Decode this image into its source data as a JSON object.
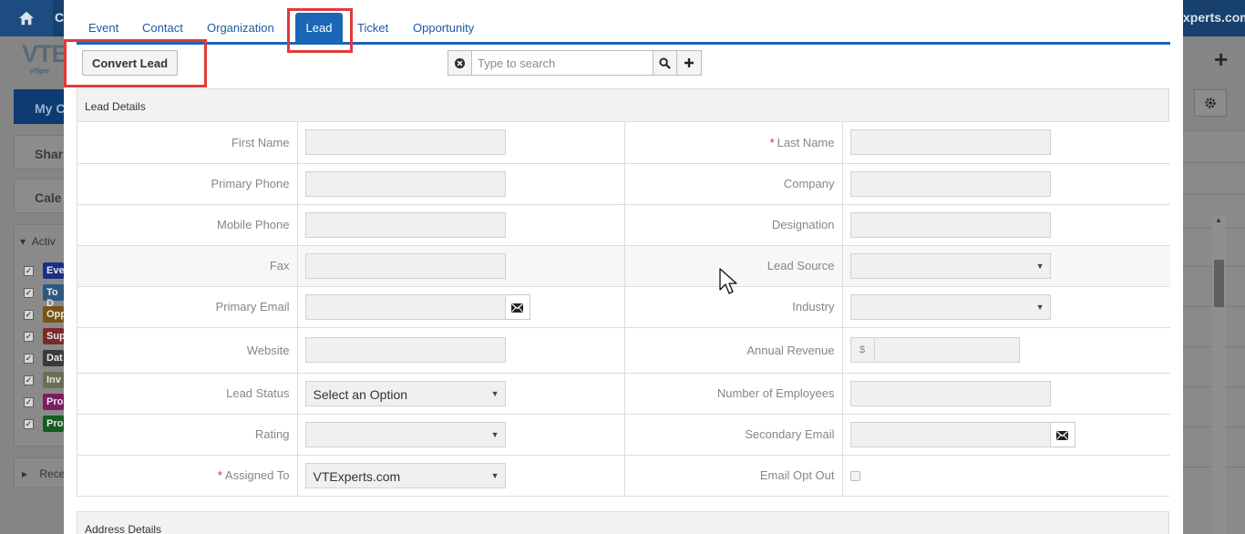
{
  "background": {
    "top_fragment": "C",
    "site_fragment": "xperts.com",
    "logo_fragment": "VTE",
    "logo_sub": "vTiger",
    "my_calendar_fragment": "My C",
    "shared_fragment": "Shar",
    "calendar_fragment": "Cale",
    "activities_fragment": "Activ",
    "recent_fragment": "Rece",
    "activity_tags": [
      {
        "label": "Eve",
        "color": "#1c2e85"
      },
      {
        "label": "To D",
        "color": "#2b5a80"
      },
      {
        "label": "Opp",
        "color": "#7a5311"
      },
      {
        "label": "Sup",
        "color": "#7a2a2a"
      },
      {
        "label": "Dat",
        "color": "#3a3a3a"
      },
      {
        "label": "Inv",
        "color": "#6b6e52"
      },
      {
        "label": "Pro",
        "color": "#7a1d63"
      },
      {
        "label": "Pro",
        "color": "#185c1f"
      }
    ]
  },
  "tabs": [
    "Event",
    "Contact",
    "Organization",
    "Lead",
    "Ticket",
    "Opportunity"
  ],
  "active_tab": "Lead",
  "convert_button": "Convert Lead",
  "search": {
    "placeholder": "Type to search",
    "value": ""
  },
  "lead_details": {
    "title": "Lead Details",
    "rows": [
      {
        "left": {
          "label": "First Name",
          "type": "text",
          "required": false,
          "value": ""
        },
        "right": {
          "label": "Last Name",
          "type": "text",
          "required": true,
          "value": ""
        }
      },
      {
        "left": {
          "label": "Primary Phone",
          "type": "text",
          "required": false,
          "value": ""
        },
        "right": {
          "label": "Company",
          "type": "text",
          "required": false,
          "value": ""
        }
      },
      {
        "left": {
          "label": "Mobile Phone",
          "type": "text",
          "required": false,
          "value": ""
        },
        "right": {
          "label": "Designation",
          "type": "text",
          "required": false,
          "value": ""
        }
      },
      {
        "left": {
          "label": "Fax",
          "type": "text",
          "required": false,
          "value": ""
        },
        "right": {
          "label": "Lead Source",
          "type": "select",
          "required": false,
          "value": ""
        }
      },
      {
        "left": {
          "label": "Primary Email",
          "type": "email",
          "required": false,
          "value": ""
        },
        "right": {
          "label": "Industry",
          "type": "select",
          "required": false,
          "value": ""
        }
      },
      {
        "left": {
          "label": "Website",
          "type": "text",
          "required": false,
          "value": ""
        },
        "right": {
          "label": "Annual Revenue",
          "type": "currency",
          "required": false,
          "value": "",
          "currency_symbol": "$"
        }
      },
      {
        "left": {
          "label": "Lead Status",
          "type": "select",
          "required": false,
          "value": "Select an Option"
        },
        "right": {
          "label": "Number of Employees",
          "type": "text",
          "required": false,
          "value": ""
        }
      },
      {
        "left": {
          "label": "Rating",
          "type": "select",
          "required": false,
          "value": ""
        },
        "right": {
          "label": "Secondary Email",
          "type": "email",
          "required": false,
          "value": ""
        }
      },
      {
        "left": {
          "label": "Assigned To",
          "type": "select",
          "required": true,
          "value": "VTExperts.com"
        },
        "right": {
          "label": "Email Opt Out",
          "type": "checkbox",
          "required": false,
          "value": false
        }
      }
    ]
  },
  "address_details": {
    "title": "Address Details"
  },
  "colors": {
    "tab_active": "#1b66b6",
    "tab_link": "#1c5aa6",
    "highlight": "#e03a3a",
    "required": "#d42a2a",
    "top_bar": "#17406d"
  },
  "icons": {
    "home": "home-icon",
    "clear": "clear-circle-icon",
    "search": "magnifier-icon",
    "add": "plus-icon",
    "mail": "envelope-icon",
    "gear": "gear-icon",
    "cursor": "mouse-pointer-icon"
  }
}
